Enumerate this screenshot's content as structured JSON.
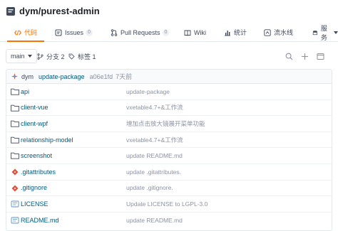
{
  "repo": {
    "title": "dym/purest-admin"
  },
  "tabs": [
    {
      "label": "代码",
      "icon": "code-icon",
      "active": true
    },
    {
      "label": "Issues",
      "icon": "issues-icon",
      "count": "0"
    },
    {
      "label": "Pull Requests",
      "icon": "pull-request-icon",
      "count": "0"
    },
    {
      "label": "Wiki",
      "icon": "wiki-icon"
    },
    {
      "label": "统计",
      "icon": "stats-icon"
    },
    {
      "label": "流水线",
      "icon": "pipeline-icon"
    },
    {
      "label": "服务",
      "icon": "service-icon",
      "dropdown": true
    }
  ],
  "toolbar": {
    "branch": "main",
    "branches_label": "分支 2",
    "tags_label": "标签 1",
    "icons": [
      "search-icon",
      "plus-icon",
      "web-ide-icon"
    ]
  },
  "commit": {
    "author": "dym",
    "message": "update-package",
    "hash": "a06e1fd",
    "time": "7天前"
  },
  "files": [
    {
      "name": "api",
      "type": "folder",
      "message": "update-package"
    },
    {
      "name": "client-vue",
      "type": "folder",
      "message": "vxetable4.7+&工作流"
    },
    {
      "name": "client-wpf",
      "type": "folder",
      "message": "增加点击放大镜展开菜单功能"
    },
    {
      "name": "relationship-model",
      "type": "folder",
      "message": "vxetable4.7+&工作流"
    },
    {
      "name": "screenshot",
      "type": "folder",
      "message": "update README.md"
    },
    {
      "name": ".gitattributes",
      "type": "git",
      "message": "update .gitattributes."
    },
    {
      "name": ".gitignore",
      "type": "git",
      "message": "update .gitignore."
    },
    {
      "name": "LICENSE",
      "type": "license",
      "message": "Update LICENSE to LGPL-3.0"
    },
    {
      "name": "README.md",
      "type": "readme",
      "message": "update README.md"
    }
  ],
  "colors": {
    "accent": "#fe7300",
    "link": "#005980",
    "muted": "#8c92a4"
  }
}
